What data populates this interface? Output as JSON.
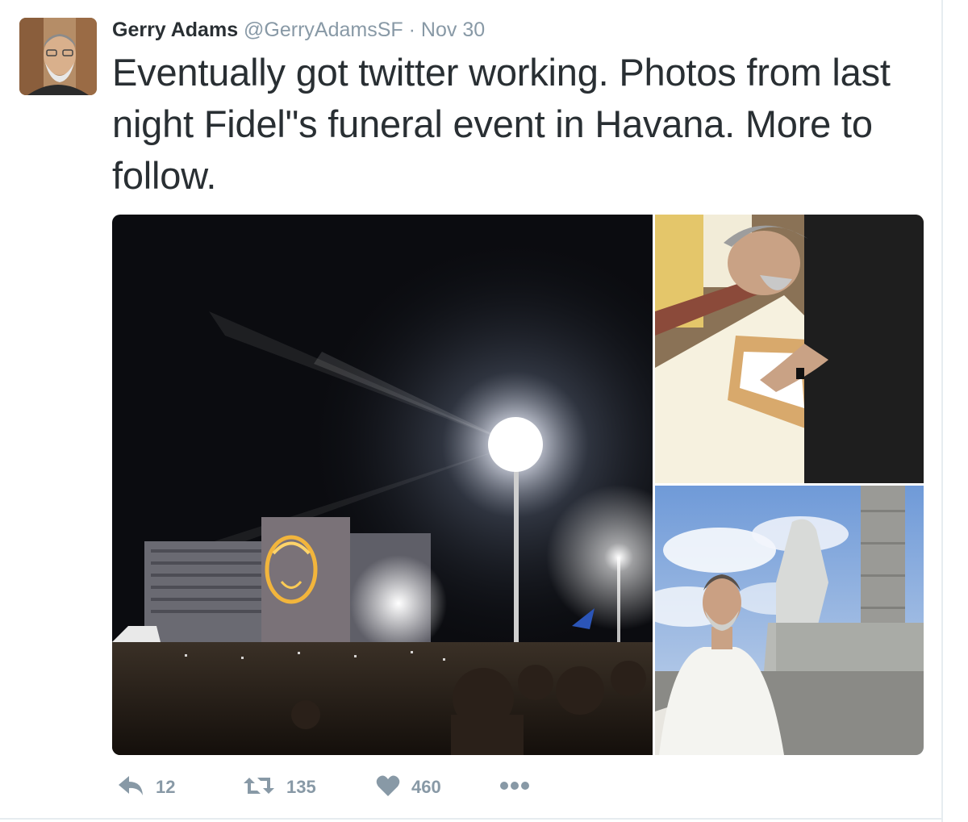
{
  "tweet": {
    "author": {
      "name": "Gerry Adams",
      "handle": "@GerryAdamsSF",
      "separator": "·",
      "time": "Nov 30"
    },
    "text": "Eventually got twitter working. Photos from last night Fidel\"s funeral  event in Havana. More to follow.",
    "photos": [
      {
        "subject": "night-rally-plaza"
      },
      {
        "subject": "signing-condolence-book"
      },
      {
        "subject": "man-at-monument"
      }
    ],
    "actions": {
      "reply_count": "12",
      "retweet_count": "135",
      "like_count": "460"
    }
  },
  "colors": {
    "text": "#292f33",
    "meta": "#8899a6",
    "divider": "#e6ecf0"
  }
}
